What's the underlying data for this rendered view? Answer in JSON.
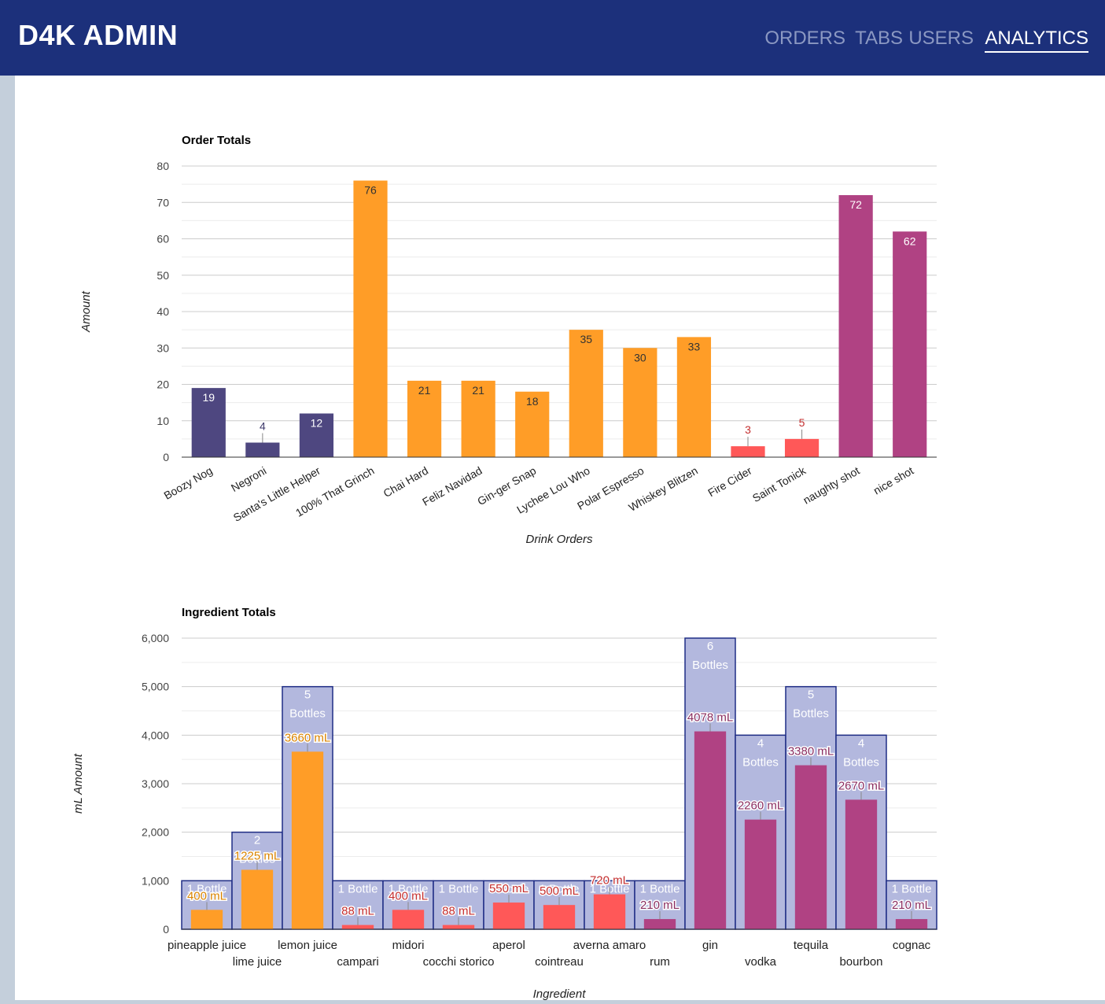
{
  "app": {
    "brand": "D4K ADMIN"
  },
  "nav": {
    "items": [
      {
        "label": "ORDERS",
        "active": false
      },
      {
        "label": "TABS",
        "active": false
      },
      {
        "label": "USERS",
        "active": false
      },
      {
        "label": "ANALYTICS",
        "active": true
      }
    ]
  },
  "colors": {
    "header_bg": "#1c307b",
    "header_link": "#8b98c2",
    "navy_series": "#4e4780",
    "orange_series": "#ff9d27",
    "red_series": "#ff5858",
    "magenta_series": "#b04283",
    "bottle_fill": "#b3b8de",
    "bottle_stroke": "#1f2d85"
  },
  "chart_data": [
    {
      "type": "bar",
      "title": "Order Totals",
      "xlabel": "Drink Orders",
      "ylabel": "Amount",
      "ylim": [
        0,
        80
      ],
      "yticks": [
        0,
        10,
        20,
        30,
        40,
        50,
        60,
        70,
        80
      ],
      "grid": true,
      "categories": [
        "Boozy Nog",
        "Negroni",
        "Santa's Little Helper",
        "100% That Grinch",
        "Chai Hard",
        "Feliz Navidad",
        "Gin-ger Snap",
        "Lychee Lou Who",
        "Polar Espresso",
        "Whiskey Blitzen",
        "Fire Cider",
        "Saint Tonick",
        "naughty shot",
        "nice shot"
      ],
      "values": [
        19,
        4,
        12,
        76,
        21,
        21,
        18,
        35,
        30,
        33,
        3,
        5,
        72,
        62
      ],
      "bar_colors": [
        "#4e4780",
        "#4e4780",
        "#4e4780",
        "#ff9d27",
        "#ff9d27",
        "#ff9d27",
        "#ff9d27",
        "#ff9d27",
        "#ff9d27",
        "#ff9d27",
        "#ff5858",
        "#ff5858",
        "#b04283",
        "#b04283"
      ],
      "data_labels": [
        "19",
        "4",
        "12",
        "76",
        "21",
        "21",
        "18",
        "35",
        "30",
        "33",
        "3",
        "5",
        "72",
        "62"
      ]
    },
    {
      "type": "bar",
      "title": "Ingredient Totals",
      "xlabel": "Ingredient",
      "ylabel": "mL Amount",
      "ylim": [
        0,
        6000
      ],
      "yticks": [
        "0",
        "1,000",
        "2,000",
        "3,000",
        "4,000",
        "5,000",
        "6,000"
      ],
      "grid": true,
      "categories": [
        "pineapple juice",
        "lime juice",
        "lemon juice",
        "campari",
        "midori",
        "cocchi storico",
        "aperol",
        "cointreau",
        "averna amaro",
        "rum",
        "gin",
        "vodka",
        "tequila",
        "bourbon",
        "cognac"
      ],
      "series": [
        {
          "values": [
            1000,
            2000,
            5000,
            1000,
            1000,
            1000,
            1000,
            1000,
            1000,
            1000,
            6000,
            4000,
            5000,
            4000,
            1000
          ],
          "data_labels": [
            [
              "1 Bottle"
            ],
            [
              "2",
              "Bottles"
            ],
            [
              "5",
              "Bottles"
            ],
            [
              "1 Bottle"
            ],
            [
              "1 Bottle"
            ],
            [
              "1 Bottle"
            ],
            [
              "1 Bottle"
            ],
            [
              "1 Bottle"
            ],
            [
              "1 Bottle"
            ],
            [
              "1 Bottle"
            ],
            [
              "6",
              "Bottles"
            ],
            [
              "4",
              "Bottles"
            ],
            [
              "5",
              "Bottles"
            ],
            [
              "4",
              "Bottles"
            ],
            [
              "1 Bottle"
            ]
          ]
        },
        {
          "values": [
            400,
            1225,
            3660,
            88,
            400,
            88,
            550,
            500,
            720,
            210,
            4078,
            2260,
            3380,
            2670,
            210
          ],
          "data_labels": [
            "400 mL",
            "1225 mL",
            "3660 mL",
            "88 mL",
            "400 mL",
            "88 mL",
            "550 mL",
            "500 mL",
            "720 mL",
            "210 mL",
            "4078 mL",
            "2260 mL",
            "3380 mL",
            "2670 mL",
            "210 mL"
          ],
          "bar_colors": [
            "#ff9d27",
            "#ff9d27",
            "#ff9d27",
            "#ff5858",
            "#ff5858",
            "#ff5858",
            "#ff5858",
            "#ff5858",
            "#ff5858",
            "#b04283",
            "#b04283",
            "#b04283",
            "#b04283",
            "#b04283",
            "#b04283"
          ]
        }
      ]
    }
  ]
}
